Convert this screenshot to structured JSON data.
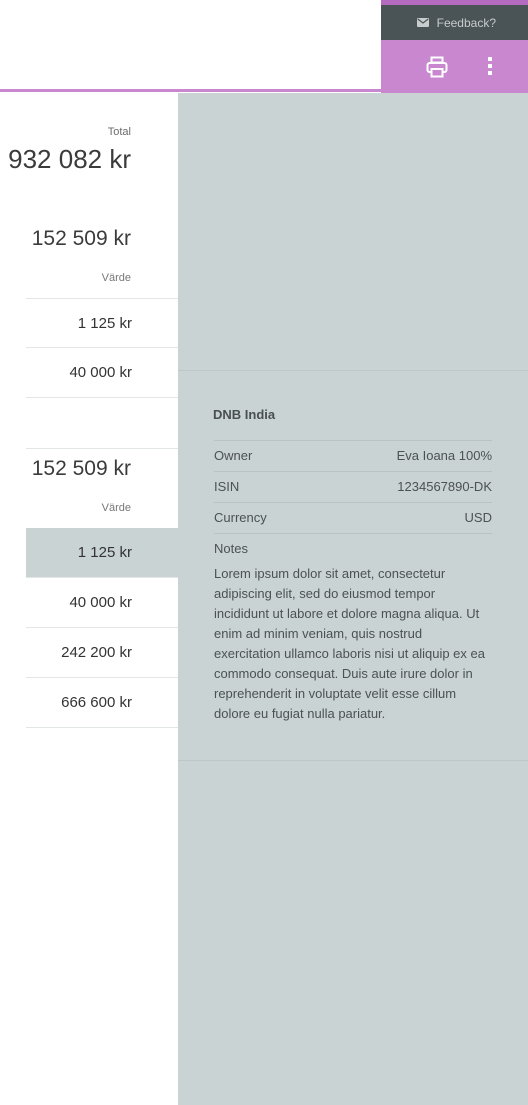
{
  "header": {
    "feedback_label": "Feedback?",
    "feedback_icon": "mail-icon",
    "print_icon": "printer-icon",
    "more_icon": "more-vertical-icon",
    "colors": {
      "accent": "#c987d0",
      "accent_dark": "#b46abf",
      "feedback_bg": "#4a5355",
      "panel_bg": "#c9d3d4"
    }
  },
  "summary": {
    "total_label": "Total",
    "total_value": "932 082 kr"
  },
  "group_1": {
    "value": "152 509 kr",
    "column_header": "Värde",
    "rows": [
      "1 125 kr",
      "40 000 kr"
    ]
  },
  "group_2": {
    "value": "152 509 kr",
    "column_header": "Värde",
    "rows": [
      "1 125 kr",
      "40 000 kr",
      "242 200 kr",
      "666 600 kr"
    ],
    "selected_index": 0
  },
  "detail": {
    "title": "DNB India",
    "owner_label": "Owner",
    "owner_value": "Eva Ioana 100%",
    "isin_label": "ISIN",
    "isin_value": "1234567890-DK",
    "currency_label": "Currency",
    "currency_value": "USD",
    "notes_label": "Notes",
    "notes_text": "Lorem ipsum dolor sit amet, consectetur adipiscing elit, sed do eiusmod tempor incididunt ut labore et dolore magna aliqua. Ut enim ad minim veniam, quis nostrud exercitation ullamco laboris nisi ut aliquip ex ea commodo consequat. Duis aute irure dolor in reprehenderit in voluptate velit esse cillum dolore eu fugiat nulla pariatur."
  }
}
